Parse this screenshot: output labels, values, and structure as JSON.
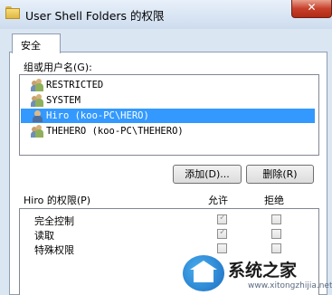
{
  "window": {
    "title": "User Shell Folders 的权限",
    "close_label": "✕"
  },
  "tabs": [
    {
      "label": "安全"
    }
  ],
  "groups_label": "组或用户名(G):",
  "users": [
    {
      "name": "RESTRICTED",
      "icon": "group-icon",
      "selected": false
    },
    {
      "name": "SYSTEM",
      "icon": "group-icon",
      "selected": false
    },
    {
      "name": "Hiro (koo-PC\\HERO)",
      "icon": "user-icon",
      "selected": true
    },
    {
      "name": "THEHERO (koo-PC\\THEHERO)",
      "icon": "group-icon",
      "selected": false
    }
  ],
  "buttons": {
    "add": "添加(D)...",
    "remove": "删除(R)"
  },
  "permissions": {
    "header": "Hiro 的权限(P)",
    "allow_label": "允许",
    "deny_label": "拒绝",
    "rows": [
      {
        "name": "完全控制",
        "allow": true,
        "deny": false
      },
      {
        "name": "读取",
        "allow": true,
        "deny": false
      },
      {
        "name": "特殊权限",
        "allow": false,
        "deny": false
      }
    ]
  },
  "watermark": {
    "text": "系统之家",
    "url": "www.xitongzhijia.net"
  }
}
